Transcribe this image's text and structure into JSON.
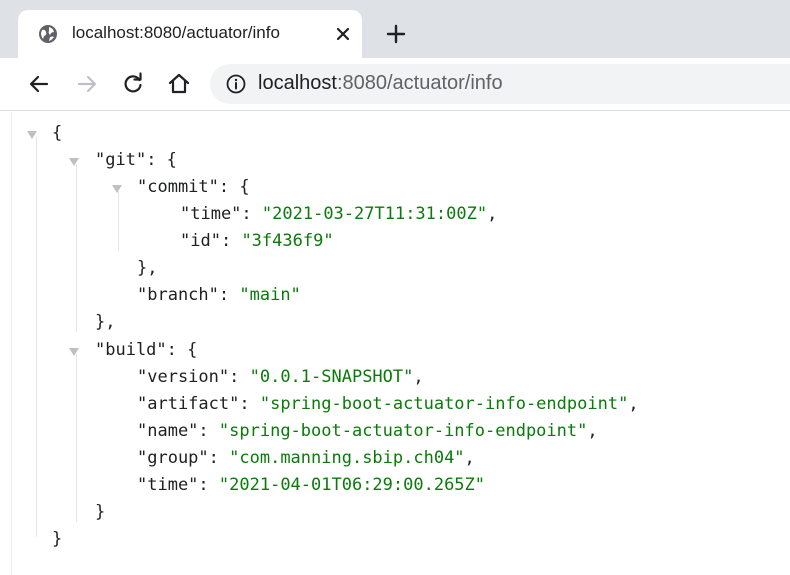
{
  "browser": {
    "tab_title": "localhost:8080/actuator/info",
    "address": {
      "host": "localhost",
      "rest": ":8080/actuator/info"
    }
  },
  "json_lines": {
    "root_open": "{",
    "git_key": "\"git\"",
    "git_open": ": {",
    "commit_key": "\"commit\"",
    "commit_open": ": {",
    "commit_time_key": "\"time\"",
    "commit_time_value": "\"2021-03-27T11:31:00Z\"",
    "commit_id_key": "\"id\"",
    "commit_id_value": "\"3f436f9\"",
    "commit_close": "},",
    "branch_key": "\"branch\"",
    "branch_value": "\"main\"",
    "git_close": "},",
    "build_key": "\"build\"",
    "build_open": ": {",
    "version_key": "\"version\"",
    "version_value": "\"0.0.1-SNAPSHOT\"",
    "artifact_key": "\"artifact\"",
    "artifact_value": "\"spring-boot-actuator-info-endpoint\"",
    "name_key": "\"name\"",
    "name_value": "\"spring-boot-actuator-info-endpoint\"",
    "group_key": "\"group\"",
    "group_value": "\"com.manning.sbip.ch04\"",
    "build_time_key": "\"time\"",
    "build_time_value": "\"2021-04-01T06:29:00.265Z\"",
    "build_close": "}",
    "root_close": "}"
  },
  "colors": {
    "tabstrip": "#dee1e6",
    "omnibox": "#f1f3f4",
    "json_string": "#0b7a0b"
  }
}
